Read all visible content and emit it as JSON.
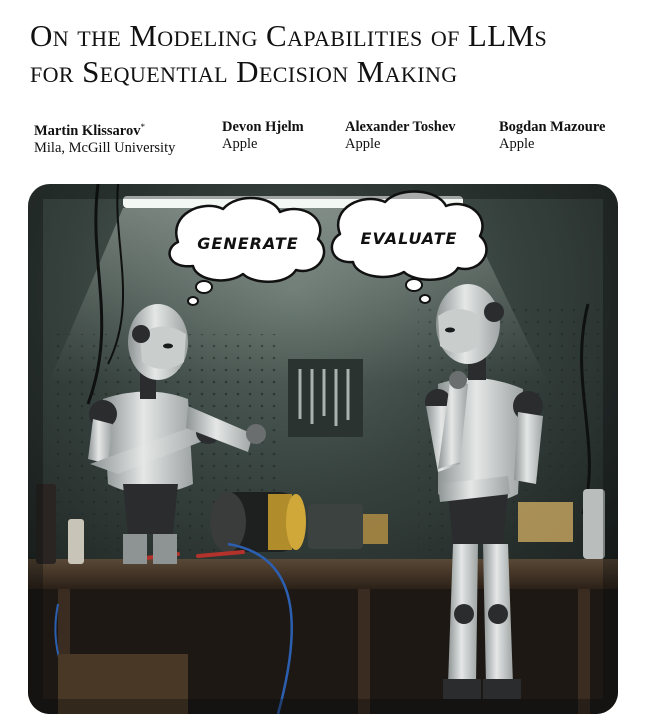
{
  "paper": {
    "title_line1": "On the Modeling Capabilities of LLMs",
    "title_line2": "for Sequential Decision Making",
    "authors": [
      {
        "name": "Martin Klissarov",
        "mark": "*",
        "affiliation": "Mila, McGill University"
      },
      {
        "name": "Devon Hjelm",
        "mark": "",
        "affiliation": "Apple"
      },
      {
        "name": "Alexander Toshev",
        "mark": "",
        "affiliation": "Apple"
      },
      {
        "name": "Bogdan Mazoure",
        "mark": "",
        "affiliation": "Apple"
      }
    ]
  },
  "figure": {
    "bubble_left": "GENERATE",
    "bubble_right": "EVALUATE",
    "scene": "two-robots-in-workshop-image",
    "colors": {
      "wall": "#3a4440",
      "wall_dark": "#1e2422",
      "bench": "#4a3a2a",
      "robot_body": "#d9dcdc",
      "robot_joint": "#2a2c2e",
      "light": "#eef4f0"
    }
  }
}
